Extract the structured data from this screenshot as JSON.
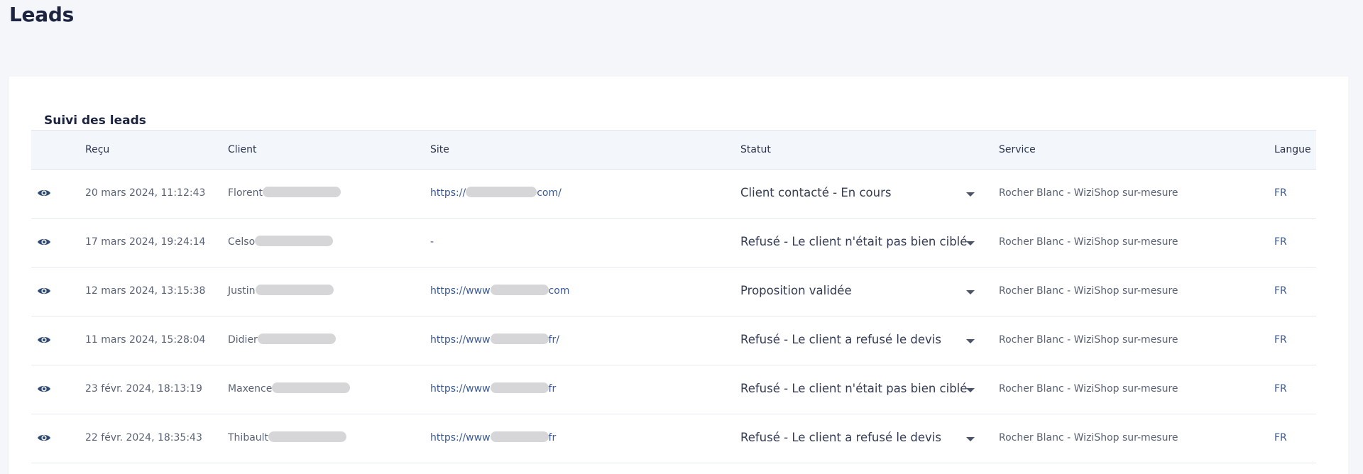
{
  "page": {
    "title": "Leads"
  },
  "card": {
    "title": "Suivi des leads"
  },
  "columns": [
    "Reçu",
    "Client",
    "Site",
    "Statut",
    "Service",
    "Langue"
  ],
  "icons": {
    "view": "eye-icon",
    "dropdown": "chevron-down-icon"
  },
  "rows": [
    {
      "recu": "20 mars 2024, 11:12:43",
      "client": "Florent",
      "site_prefix": "https://",
      "site_suffix": "com/",
      "statut": "Client contacté - En cours",
      "service": "Rocher Blanc - WiziShop sur-mesure",
      "langue": "FR"
    },
    {
      "recu": "17 mars 2024, 19:24:14",
      "client": "Celso",
      "site_prefix": "-",
      "site_suffix": "",
      "statut": "Refusé - Le client n'était pas bien ciblé",
      "service": "Rocher Blanc - WiziShop sur-mesure",
      "langue": "FR"
    },
    {
      "recu": "12 mars 2024, 13:15:38",
      "client": "Justin",
      "site_prefix": "https://www",
      "site_suffix": "com",
      "statut": "Proposition validée",
      "service": "Rocher Blanc - WiziShop sur-mesure",
      "langue": "FR"
    },
    {
      "recu": "11 mars 2024, 15:28:04",
      "client": "Didier",
      "site_prefix": "https://www",
      "site_suffix": "fr/",
      "statut": "Refusé - Le client a refusé le devis",
      "service": "Rocher Blanc - WiziShop sur-mesure",
      "langue": "FR"
    },
    {
      "recu": "23 févr. 2024, 18:13:19",
      "client": "Maxence",
      "site_prefix": "https://www",
      "site_suffix": "fr",
      "statut": "Refusé - Le client n'était pas bien ciblé",
      "service": "Rocher Blanc - WiziShop sur-mesure",
      "langue": "FR"
    },
    {
      "recu": "22 févr. 2024, 18:35:43",
      "client": "Thibault",
      "site_prefix": "https://www",
      "site_suffix": "fr",
      "statut": "Refusé - Le client a refusé le devis",
      "service": "Rocher Blanc - WiziShop sur-mesure",
      "langue": "FR"
    }
  ],
  "colors": {
    "background": "#f4f6fa",
    "card": "#ffffff",
    "header_row": "#f3f6fa",
    "link": "#3b5a95",
    "title": "#1c2440"
  }
}
